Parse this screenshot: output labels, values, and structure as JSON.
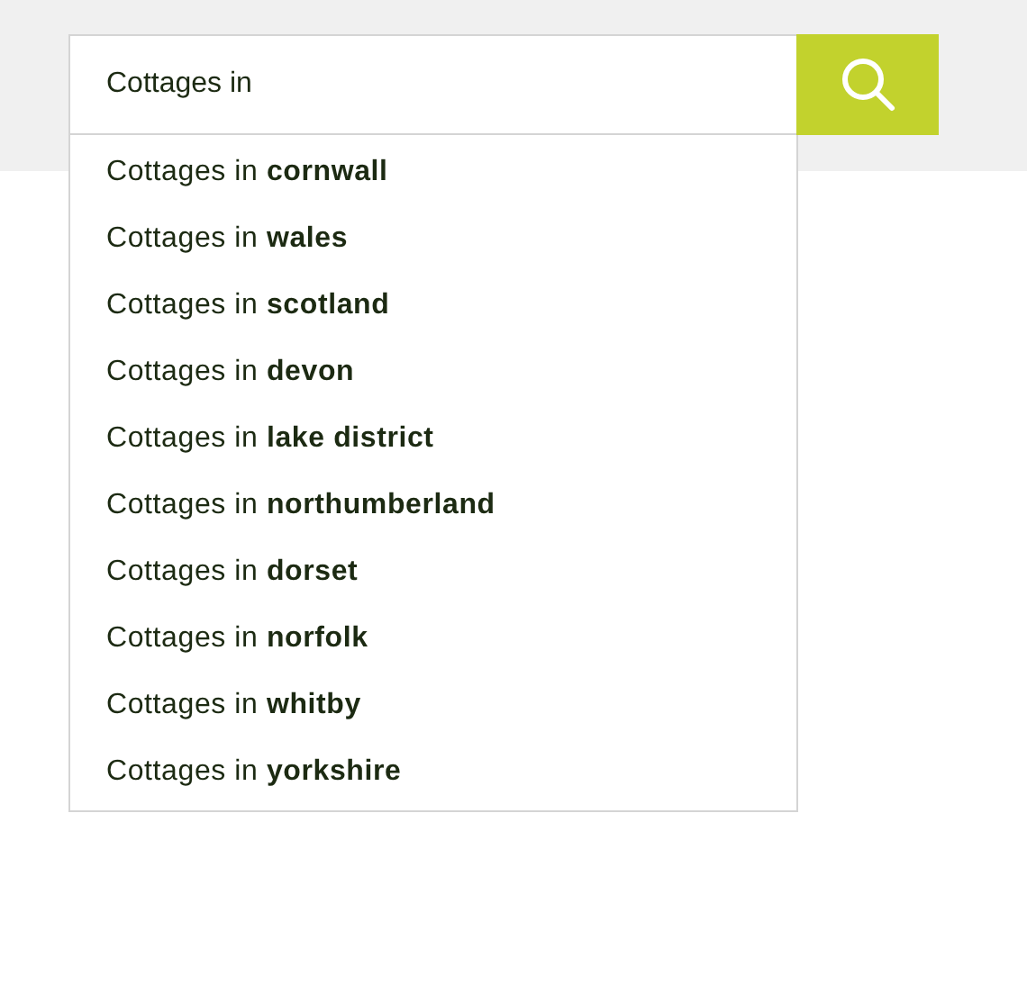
{
  "search": {
    "value": "Cottages in"
  },
  "suggestions": [
    {
      "text": "Cottages in **cornwall**"
    },
    {
      "text": "Cottages in **wales**"
    },
    {
      "text": "Cottages in **scotland**"
    },
    {
      "text": "Cottages in **devon**"
    },
    {
      "text": "Cottages in **lake district**"
    },
    {
      "text": "Cottages in **northumberland**"
    },
    {
      "text": "Cottages in **dorset**"
    },
    {
      "text": "Cottages in **norfolk**"
    },
    {
      "text": "Cottages in **whitby**"
    },
    {
      "text": "Cottages in **yorkshire**"
    }
  ]
}
